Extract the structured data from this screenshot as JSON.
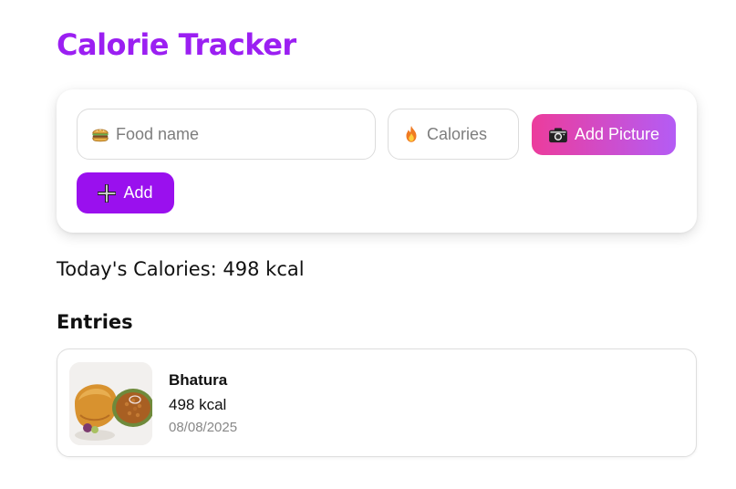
{
  "app": {
    "title": "Calorie Tracker"
  },
  "form": {
    "food_placeholder": "Food name",
    "food_value": "",
    "calories_placeholder": "Calories",
    "calories_value": "",
    "add_picture_label": "Add Picture",
    "add_label": "Add"
  },
  "summary": {
    "today_text": "Today's Calories: 498 kcal"
  },
  "entries": {
    "heading": "Entries",
    "items": [
      {
        "name": "Bhatura",
        "calories": "498 kcal",
        "date": "08/08/2025",
        "image_icon": "food-photo"
      }
    ]
  },
  "icons": {
    "food": "burger-icon",
    "calories": "fire-icon",
    "picture": "camera-icon",
    "add": "plus-icon"
  },
  "colors": {
    "brand": "#9b1ff2",
    "add_button": "#9a10ee",
    "picture_gradient_start": "#ec3c9c",
    "picture_gradient_end": "#b45cf5"
  }
}
